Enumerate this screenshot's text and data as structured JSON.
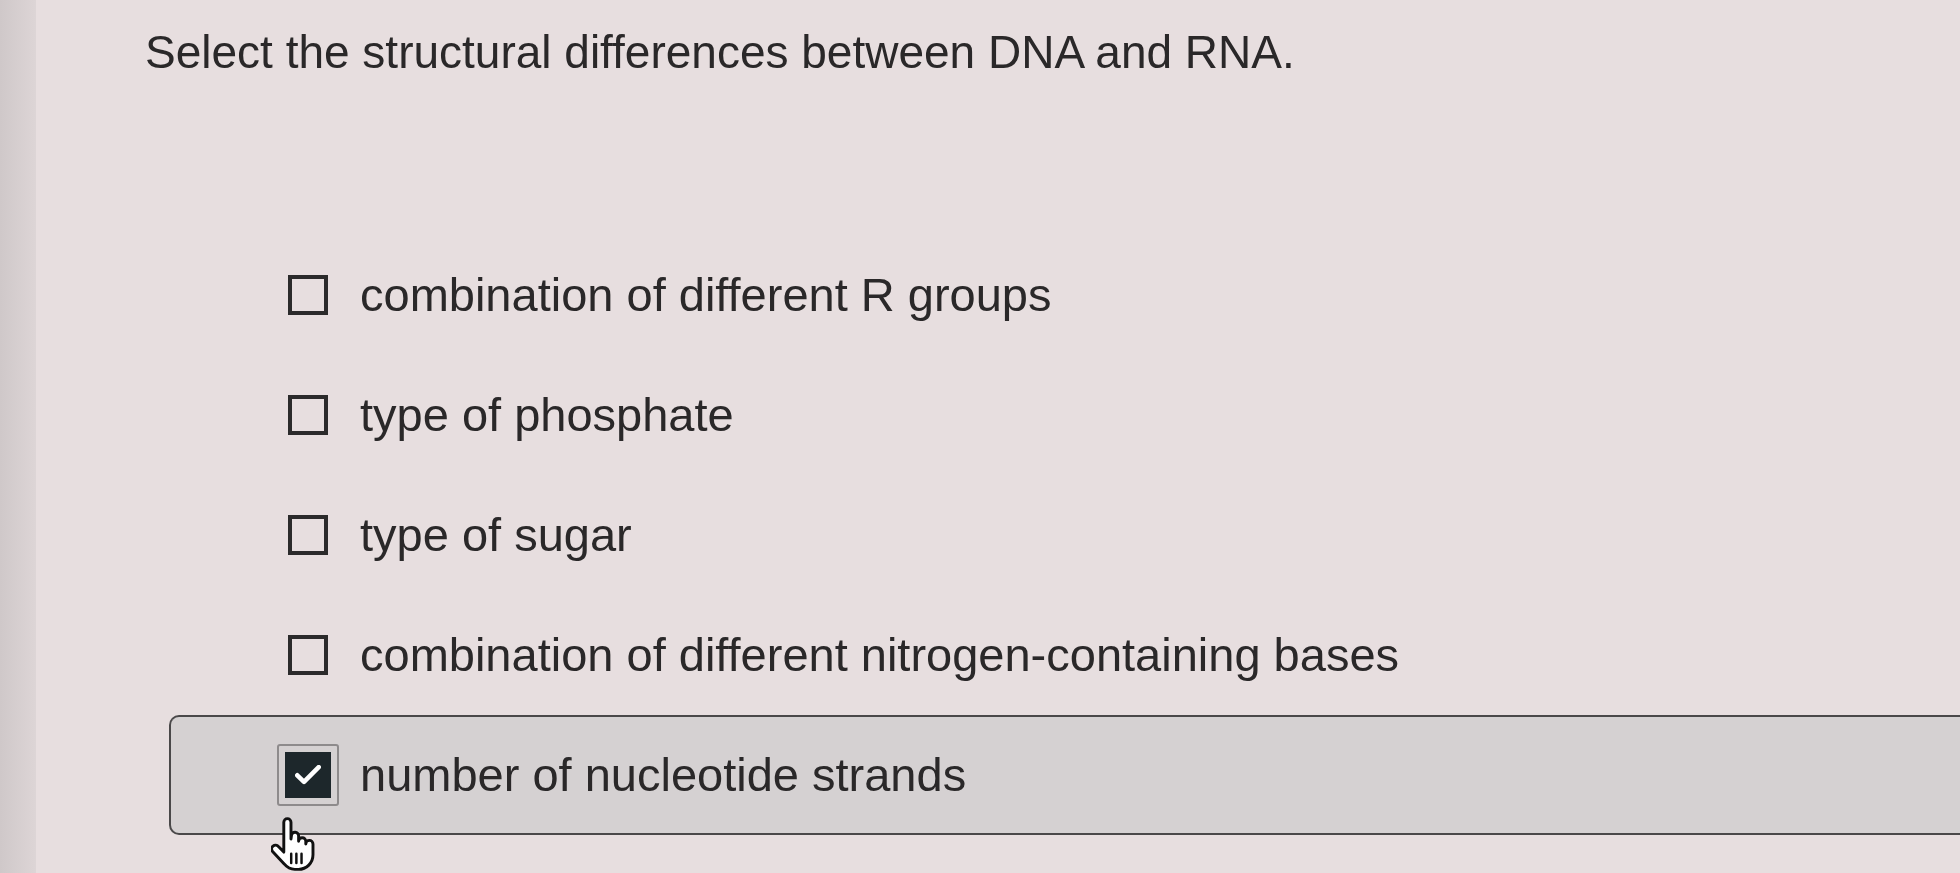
{
  "question": "Select the structural differences between DNA and RNA.",
  "options": [
    {
      "label": "combination of different R groups",
      "checked": false,
      "hovered": false
    },
    {
      "label": "type of phosphate",
      "checked": false,
      "hovered": false
    },
    {
      "label": "type of sugar",
      "checked": false,
      "hovered": false
    },
    {
      "label": "combination of different nitrogen-containing bases",
      "checked": false,
      "hovered": false
    },
    {
      "label": "number of nucleotide strands",
      "checked": true,
      "hovered": true
    }
  ]
}
